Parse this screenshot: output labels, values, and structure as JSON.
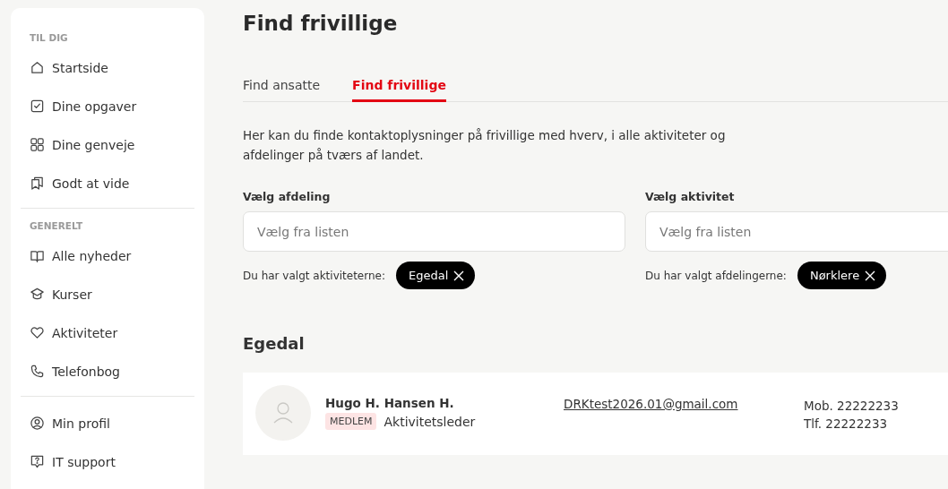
{
  "sidebar": {
    "sections": [
      {
        "heading": "TIL DIG",
        "items": [
          {
            "label": "Startside"
          },
          {
            "label": "Dine opgaver"
          },
          {
            "label": "Dine genveje"
          },
          {
            "label": "Godt at vide"
          }
        ]
      },
      {
        "heading": "GENERELT",
        "items": [
          {
            "label": "Alle nyheder"
          },
          {
            "label": "Kurser"
          },
          {
            "label": "Aktiviteter"
          },
          {
            "label": "Telefonbog"
          }
        ]
      },
      {
        "items": [
          {
            "label": "Min profil"
          },
          {
            "label": "IT support"
          }
        ]
      }
    ]
  },
  "page_title": "Find frivillige",
  "tabs": [
    {
      "label": "Find ansatte",
      "selected": false
    },
    {
      "label": "Find frivillige",
      "selected": true
    }
  ],
  "description": "Her kan du finde kontaktoplysninger på frivillige med hverv, i alle aktiviteter og afdelinger på tværs af landet.",
  "filters": [
    {
      "label": "Vælg afdeling",
      "placeholder": "Vælg fra listen",
      "chosen_label": "Du har valgt aktiviteterne:",
      "chips": [
        "Egedal"
      ]
    },
    {
      "label": "Vælg aktivitet",
      "placeholder": "Vælg fra listen",
      "chosen_label": "Du har valgt afdelingerne:",
      "chips": [
        "Nørklere"
      ]
    }
  ],
  "groups": [
    {
      "heading": "Egedal",
      "people": [
        {
          "name": "Hugo H. Hansen H.",
          "badge": "MEDLEM",
          "role": "Aktivitetsleder",
          "email": "DRKtest2026.01@gmail.com",
          "mobile": "Mob. 22222233",
          "phone": "Tlf. 22222233"
        }
      ]
    }
  ]
}
